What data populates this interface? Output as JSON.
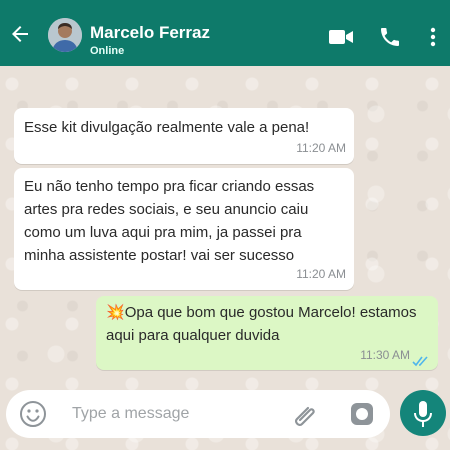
{
  "header": {
    "contact_name": "Marcelo Ferraz",
    "status": "Online",
    "back_icon": "back-arrow-icon",
    "video_icon": "video-call-icon",
    "call_icon": "phone-icon",
    "menu_icon": "more-vertical-icon"
  },
  "messages": [
    {
      "direction": "incoming",
      "text": "Esse kit divulgação realmente vale a pena!",
      "time": "11:20 AM"
    },
    {
      "direction": "incoming",
      "text": "Eu não tenho tempo pra ficar criando essas artes pra redes sociais, e seu anuncio caiu como um luva aqui pra mim, ja passei pra minha assistente postar! vai ser sucesso",
      "time": "11:20 AM"
    },
    {
      "direction": "outgoing",
      "emoji": "💥",
      "text": "Opa que bom que gostou Marcelo! estamos aqui para qualquer duvida",
      "time": "11:30 AM",
      "read_receipt": "read"
    }
  ],
  "composer": {
    "placeholder": "Type a message",
    "emoji_icon": "emoji-icon",
    "attach_icon": "paperclip-icon",
    "camera_icon": "camera-icon",
    "mic_icon": "microphone-icon"
  },
  "colors": {
    "header": "#0e7a6a",
    "incoming_bubble": "#ffffff",
    "outgoing_bubble": "#dcf7c5",
    "mic_button": "#14857a",
    "read_ticks": "#4fb6ec"
  }
}
